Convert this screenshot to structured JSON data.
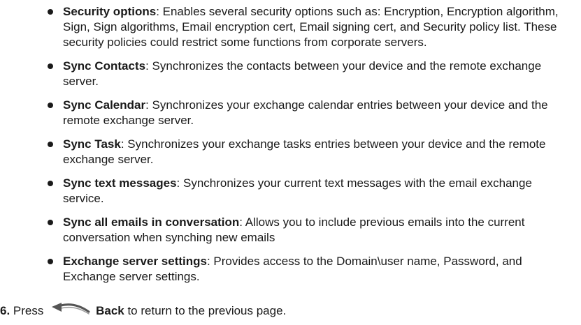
{
  "bullets": [
    {
      "term": "Security options",
      "desc": ": Enables several security options such as: Encryption, Encryption algorithm, Sign, Sign algorithms, Email encryption cert, Email signing cert, and Security policy list. These security policies could restrict some functions from corporate servers."
    },
    {
      "term": "Sync Contacts",
      "desc": ": Synchronizes the contacts between your device and the remote exchange server."
    },
    {
      "term": "Sync Calendar",
      "desc": ": Synchronizes your exchange calendar entries between your device and the remote exchange server."
    },
    {
      "term": "Sync Task",
      "desc": ": Synchronizes your exchange tasks entries between your device and the remote exchange server."
    },
    {
      "term": "Sync text messages",
      "desc": ": Synchronizes your current text messages with the email exchange service."
    },
    {
      "term": "Sync all emails in conversation",
      "desc": ": Allows you to include previous emails into the current conversation when synching new emails"
    },
    {
      "term": "Exchange server settings",
      "desc": ": Provides access to the Domain\\user name, Password, and Exchange server settings."
    }
  ],
  "step": {
    "number": "6.",
    "pre": " Press ",
    "icon": "back-arrow-icon",
    "label": "Back",
    "post": " to return to the previous page."
  }
}
